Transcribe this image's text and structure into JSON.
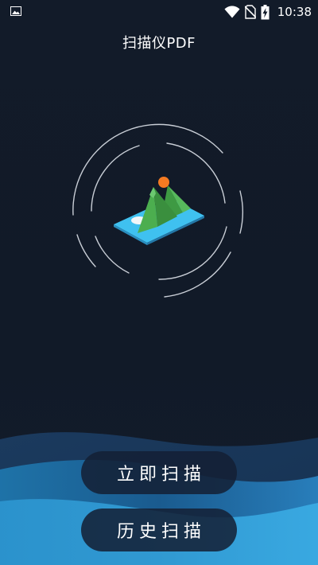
{
  "status_bar": {
    "time": "10:38",
    "left_icon": "gallery-icon",
    "right_icons": [
      "wifi-icon",
      "no-sim-icon",
      "battery-charging-icon"
    ]
  },
  "app": {
    "title": "扫描仪PDF"
  },
  "actions": {
    "scan_now_label": "立即扫描",
    "history_label": "历史扫描"
  },
  "colors": {
    "background": "#111a28",
    "mountain_green": "#4cae4f",
    "water_blue": "#3fc1f0",
    "sun_orange": "#f47a22",
    "wave_light": "#1f7fb8",
    "wave_dark": "#1b3d63",
    "button_bg": "#14203a"
  }
}
